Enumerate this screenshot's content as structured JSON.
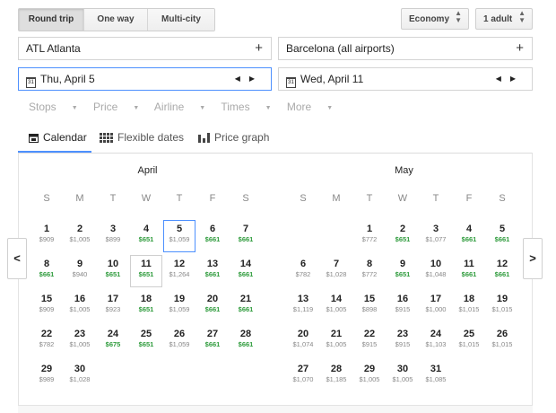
{
  "trip_types": [
    "Round trip",
    "One way",
    "Multi-city"
  ],
  "trip_active": 0,
  "cabin": {
    "selected": "Economy"
  },
  "passengers": {
    "selected": "1 adult"
  },
  "origin": {
    "value": "ATL Atlanta",
    "add": "+"
  },
  "destination": {
    "value": "Barcelona (all airports)",
    "add": "+"
  },
  "depart": {
    "icon_text": "31",
    "value": "Thu, April 5"
  },
  "return": {
    "icon_text": "31",
    "value": "Wed, April 11"
  },
  "filters": [
    "Stops",
    "Price",
    "Airline",
    "Times",
    "More"
  ],
  "views": [
    {
      "label": "Calendar",
      "icon": "calendar-icon"
    },
    {
      "label": "Flexible dates",
      "icon": "grid-icon"
    },
    {
      "label": "Price graph",
      "icon": "bar-chart-icon"
    }
  ],
  "active_view": 0,
  "weekdays": [
    "S",
    "M",
    "T",
    "W",
    "T",
    "F",
    "S"
  ],
  "low_color": "#2e9b3c",
  "selection_color": "#4d90fe",
  "months": [
    {
      "name": "April",
      "first_weekday": 0,
      "days": [
        {
          "d": "1",
          "p": "$909"
        },
        {
          "d": "2",
          "p": "$1,005"
        },
        {
          "d": "3",
          "p": "$899"
        },
        {
          "d": "4",
          "p": "$651",
          "low": true
        },
        {
          "d": "5",
          "p": "$1,059",
          "selected": "depart"
        },
        {
          "d": "6",
          "p": "$661",
          "low": true
        },
        {
          "d": "7",
          "p": "$661",
          "low": true
        },
        {
          "d": "8",
          "p": "$661",
          "low": true
        },
        {
          "d": "9",
          "p": "$940"
        },
        {
          "d": "10",
          "p": "$651",
          "low": true
        },
        {
          "d": "11",
          "p": "$651",
          "low": true,
          "selected": "return"
        },
        {
          "d": "12",
          "p": "$1,264"
        },
        {
          "d": "13",
          "p": "$661",
          "low": true
        },
        {
          "d": "14",
          "p": "$661",
          "low": true
        },
        {
          "d": "15",
          "p": "$909"
        },
        {
          "d": "16",
          "p": "$1,005"
        },
        {
          "d": "17",
          "p": "$923"
        },
        {
          "d": "18",
          "p": "$651",
          "low": true
        },
        {
          "d": "19",
          "p": "$1,059"
        },
        {
          "d": "20",
          "p": "$661",
          "low": true
        },
        {
          "d": "21",
          "p": "$661",
          "low": true
        },
        {
          "d": "22",
          "p": "$782"
        },
        {
          "d": "23",
          "p": "$1,005"
        },
        {
          "d": "24",
          "p": "$675",
          "low": true
        },
        {
          "d": "25",
          "p": "$651",
          "low": true
        },
        {
          "d": "26",
          "p": "$1,059"
        },
        {
          "d": "27",
          "p": "$661",
          "low": true
        },
        {
          "d": "28",
          "p": "$661",
          "low": true
        },
        {
          "d": "29",
          "p": "$989"
        },
        {
          "d": "30",
          "p": "$1,028"
        }
      ]
    },
    {
      "name": "May",
      "first_weekday": 2,
      "days": [
        {
          "d": "1",
          "p": "$772"
        },
        {
          "d": "2",
          "p": "$651",
          "low": true
        },
        {
          "d": "3",
          "p": "$1,077"
        },
        {
          "d": "4",
          "p": "$661",
          "low": true
        },
        {
          "d": "5",
          "p": "$661",
          "low": true
        },
        {
          "d": "6",
          "p": "$782"
        },
        {
          "d": "7",
          "p": "$1,028"
        },
        {
          "d": "8",
          "p": "$772"
        },
        {
          "d": "9",
          "p": "$651",
          "low": true
        },
        {
          "d": "10",
          "p": "$1,048"
        },
        {
          "d": "11",
          "p": "$661",
          "low": true
        },
        {
          "d": "12",
          "p": "$661",
          "low": true
        },
        {
          "d": "13",
          "p": "$1,119"
        },
        {
          "d": "14",
          "p": "$1,005"
        },
        {
          "d": "15",
          "p": "$898"
        },
        {
          "d": "16",
          "p": "$915"
        },
        {
          "d": "17",
          "p": "$1,000"
        },
        {
          "d": "18",
          "p": "$1,015"
        },
        {
          "d": "19",
          "p": "$1,015"
        },
        {
          "d": "20",
          "p": "$1,074"
        },
        {
          "d": "21",
          "p": "$1,005"
        },
        {
          "d": "22",
          "p": "$915"
        },
        {
          "d": "23",
          "p": "$915"
        },
        {
          "d": "24",
          "p": "$1,103"
        },
        {
          "d": "25",
          "p": "$1,015"
        },
        {
          "d": "26",
          "p": "$1,015"
        },
        {
          "d": "27",
          "p": "$1,070"
        },
        {
          "d": "28",
          "p": "$1,185"
        },
        {
          "d": "29",
          "p": "$1,005"
        },
        {
          "d": "30",
          "p": "$1,005"
        },
        {
          "d": "31",
          "p": "$1,085"
        }
      ]
    }
  ],
  "nav": {
    "prev": "<",
    "next": ">"
  }
}
